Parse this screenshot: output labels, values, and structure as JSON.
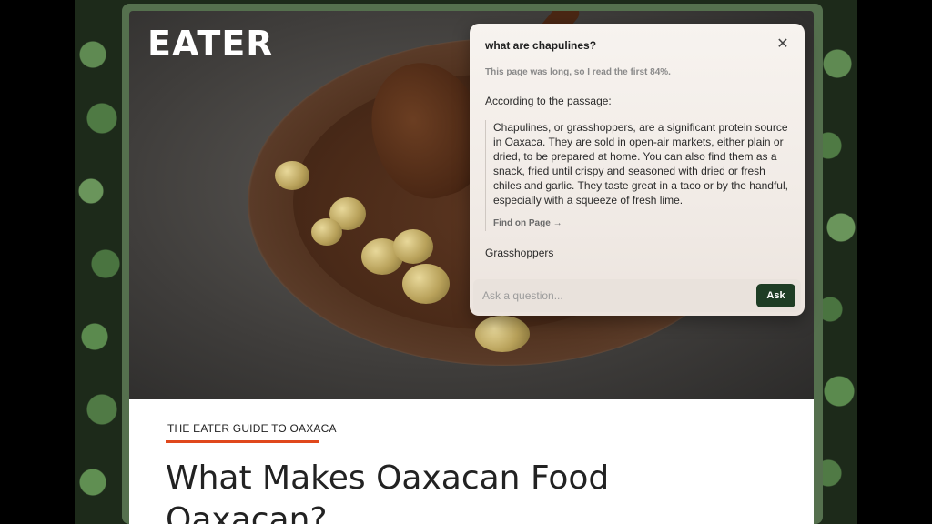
{
  "site": {
    "logo_text": "EATER"
  },
  "article": {
    "kicker": "THE EATER GUIDE TO OAXACA",
    "headline": "What Makes Oaxacan Food Oaxacan?"
  },
  "ask_panel": {
    "query": "what are chapulines?",
    "truncation_note": "This page was long, so I read the first 84%.",
    "intro": "According to the passage:",
    "quote": "Chapulines, or grasshoppers, are a significant protein source in Oaxaca. They are sold in open-air markets, either plain or dried, to be prepared at home. You can also find them as a snack, fried until crispy and seasoned with dried or fresh chiles and garlic. They taste great in a taco or by the handful, especially with a squeeze of fresh lime.",
    "find_on_page_label": "Find on Page",
    "find_arrow": "→",
    "short_answer": "Grasshoppers",
    "input_placeholder": "Ask a question...",
    "ask_button_label": "Ask",
    "close_glyph": "✕"
  },
  "colors": {
    "window_frame": "#55704e",
    "kicker_underline": "#e0481c",
    "ask_button": "#1e3d25"
  }
}
